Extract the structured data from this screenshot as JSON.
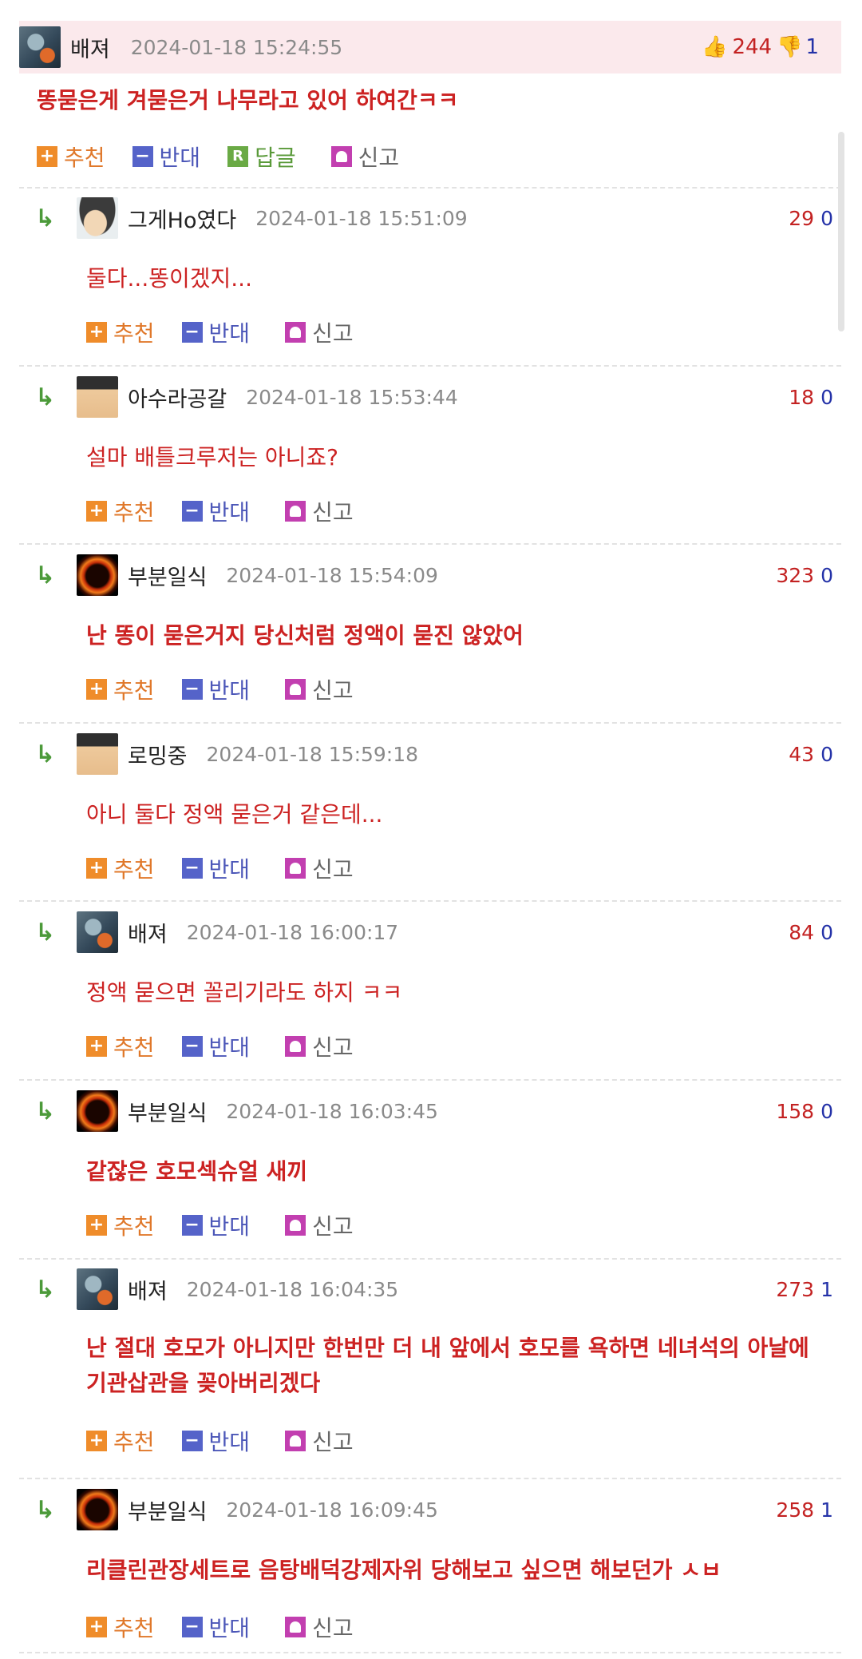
{
  "op": {
    "name": "배져",
    "date": "2024-01-18 15:24:55",
    "up": "244",
    "down": "1",
    "comment": "똥묻은게 겨묻은거 나무라고 있어 하여간ㅋㅋ",
    "actions": {
      "recommend": "추천",
      "oppose": "반대",
      "reply": "답글",
      "report": "신고"
    }
  },
  "action_labels": {
    "recommend": "추천",
    "oppose": "반대",
    "report": "신고"
  },
  "replies": [
    {
      "name": "그게Ho였다",
      "date": "2024-01-18 15:51:09",
      "up": "29",
      "down": "0",
      "text": "둘다...똥이겠지..."
    },
    {
      "name": "아수라공갈",
      "date": "2024-01-18 15:53:44",
      "up": "18",
      "down": "0",
      "text": "설마 배틀크루저는 아니죠?"
    },
    {
      "name": "부분일식",
      "date": "2024-01-18 15:54:09",
      "up": "323",
      "down": "0",
      "text": "난 똥이 묻은거지 당신처럼 정액이 묻진 않았어"
    },
    {
      "name": "로밍중",
      "date": "2024-01-18 15:59:18",
      "up": "43",
      "down": "0",
      "text": "아니 둘다 정액 묻은거 같은데..."
    },
    {
      "name": "배져",
      "date": "2024-01-18 16:00:17",
      "up": "84",
      "down": "0",
      "text": "정액 묻으면 꼴리기라도 하지 ㅋㅋ"
    },
    {
      "name": "부분일식",
      "date": "2024-01-18 16:03:45",
      "up": "158",
      "down": "0",
      "text": "같잖은 호모섹슈얼 새끼"
    },
    {
      "name": "배져",
      "date": "2024-01-18 16:04:35",
      "up": "273",
      "down": "1",
      "text": "난 절대 호모가 아니지만 한번만 더 내 앞에서 호모를 욕하면 네녀석의 아날에 기관삽관을 꽂아버리겠다"
    },
    {
      "name": "부분일식",
      "date": "2024-01-18 16:09:45",
      "up": "258",
      "down": "1",
      "text": "리클린관장세트로 음탕배덕강제자위 당해보고 싶으면 해보던가 ㅅㅂ"
    }
  ],
  "icons": [
    "robot-avatar",
    "character-avatar",
    "eclipse-avatar",
    "thumbs-up-icon",
    "thumbs-down-icon",
    "reply-arrow-icon",
    "plus-icon",
    "minus-icon",
    "reply-r-icon",
    "siren-icon"
  ],
  "colors": {
    "accent_red": "#cc2222",
    "down_blue": "#2432a8",
    "op_bg": "#fbe9ec",
    "recommend_orange": "#ef8c2a",
    "oppose_blue": "#5563c9"
  }
}
